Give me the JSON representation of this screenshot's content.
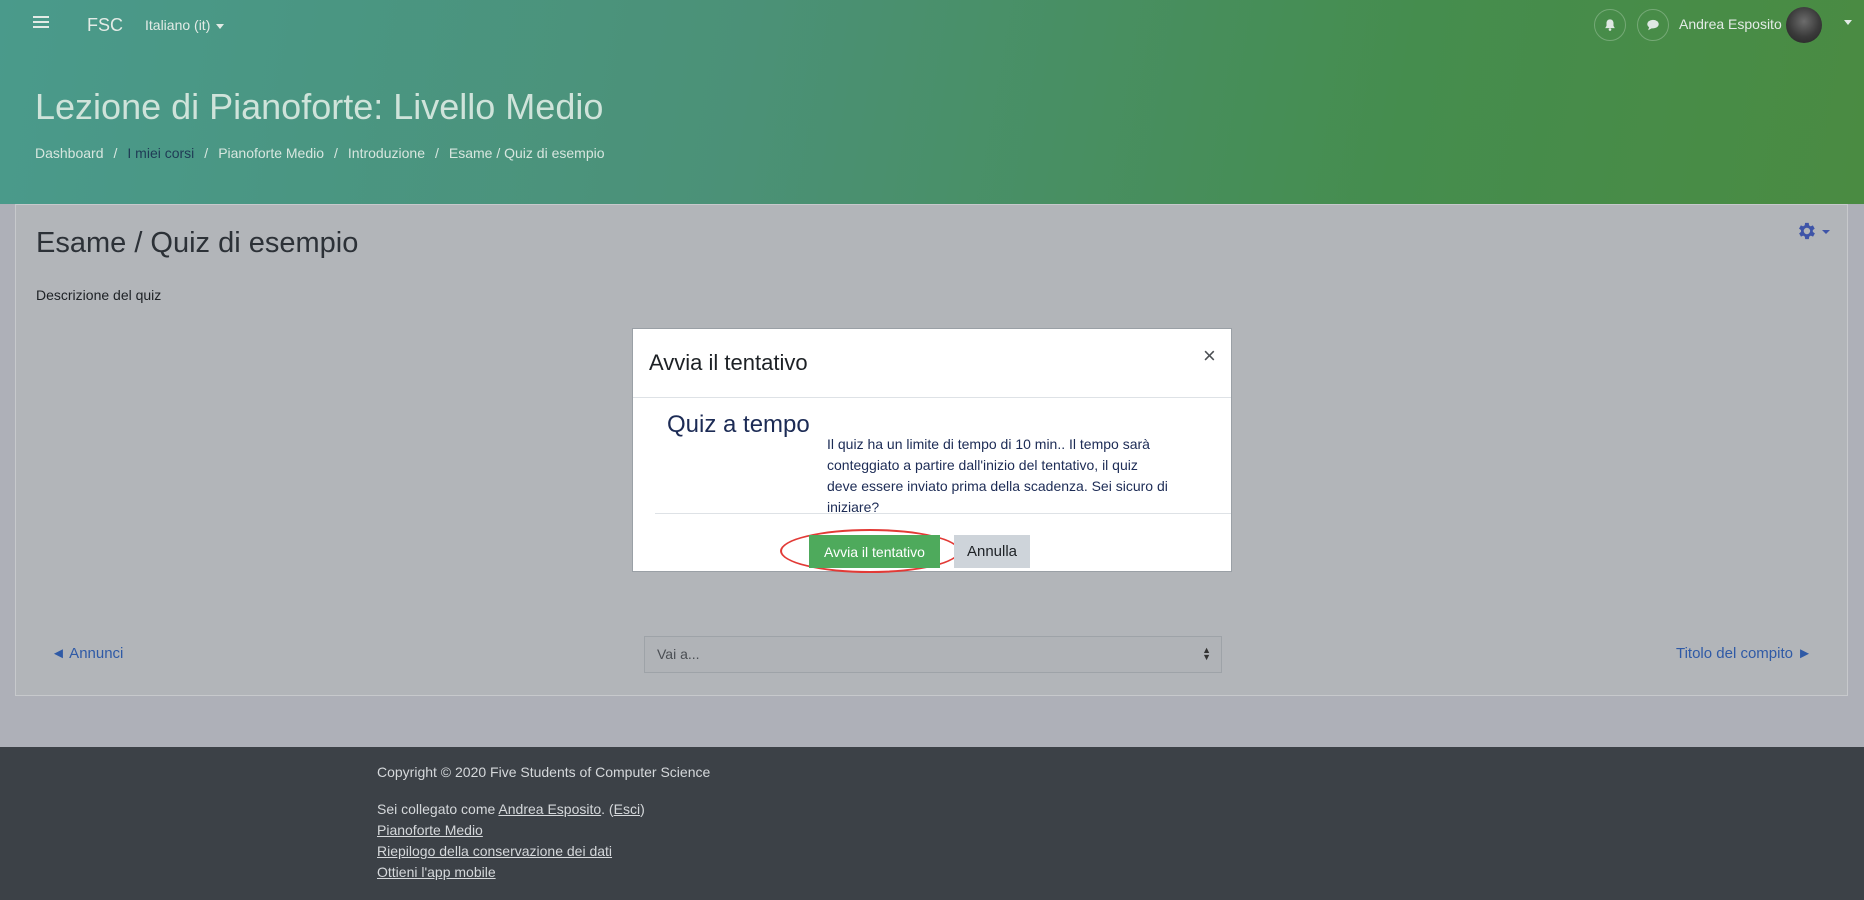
{
  "nav": {
    "brand": "FSC",
    "language": "Italiano (it)",
    "user_name": "Andrea Esposito"
  },
  "header": {
    "title": "Lezione di Pianoforte: Livello Medio",
    "breadcrumb": [
      "Dashboard",
      "I miei corsi",
      "Pianoforte Medio",
      "Introduzione",
      "Esame / Quiz di esempio"
    ]
  },
  "main": {
    "title": "Esame / Quiz di esempio",
    "description": "Descrizione del quiz",
    "prev_link": "◄ Annunci",
    "next_link": "Titolo del compito ►",
    "jump_placeholder": "Vai a..."
  },
  "modal": {
    "title": "Avvia il tentativo",
    "close": "×",
    "heading": "Quiz a tempo",
    "text": "Il quiz ha un limite di tempo di 10 min.. Il tempo sarà conteggiato a partire dall'inizio del tentativo, il quiz deve essere inviato prima della scadenza. Sei sicuro di iniziare?",
    "start_button": "Avvia il tentativo",
    "cancel_button": "Annulla"
  },
  "footer": {
    "copyright": "Copyright © 2020 Five Students of Computer Science",
    "logged_in_prefix": "Sei collegato come",
    "logged_in_user": "Andrea Esposito",
    "logged_in_sep": ". (",
    "logout": "Esci",
    "logged_in_end": ")",
    "links": [
      "Pianoforte Medio",
      "Riepilogo della conservazione dei dati",
      "Ottieni l'app mobile"
    ]
  },
  "colors": {
    "start_button": "#4eaa5c",
    "highlight_ring": "#e23a36",
    "link": "#2f5aa6"
  }
}
